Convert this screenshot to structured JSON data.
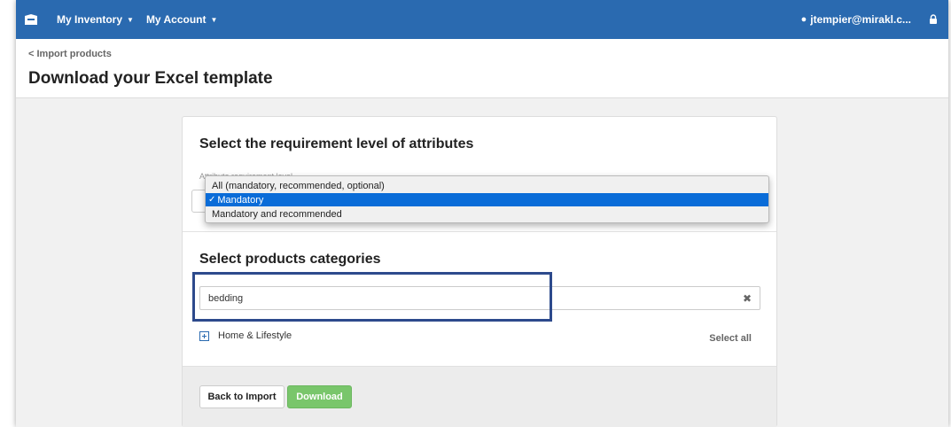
{
  "nav": {
    "menu1": "My Inventory",
    "menu2": "My Account",
    "user": "jtempier@mirakl.c..."
  },
  "breadcrumb": "< Import products",
  "page_title": "Download your Excel template",
  "requirement": {
    "title": "Select the requirement level of attributes",
    "label": "Attribute requirement level",
    "options": [
      "All (mandatory, recommended, optional)",
      "Mandatory",
      "Mandatory and recommended"
    ],
    "selected": "Mandatory"
  },
  "categories": {
    "title": "Select products categories",
    "search_value": "bedding",
    "tree_item": "Home & Lifestyle",
    "select_all": "Select all"
  },
  "buttons": {
    "back": "Back to Import",
    "download": "Download"
  },
  "colors": {
    "navbar": "#2a6ab0",
    "download": "#79c66b",
    "highlight": "#2d4a8c",
    "selected_option": "#0a6cd8"
  }
}
